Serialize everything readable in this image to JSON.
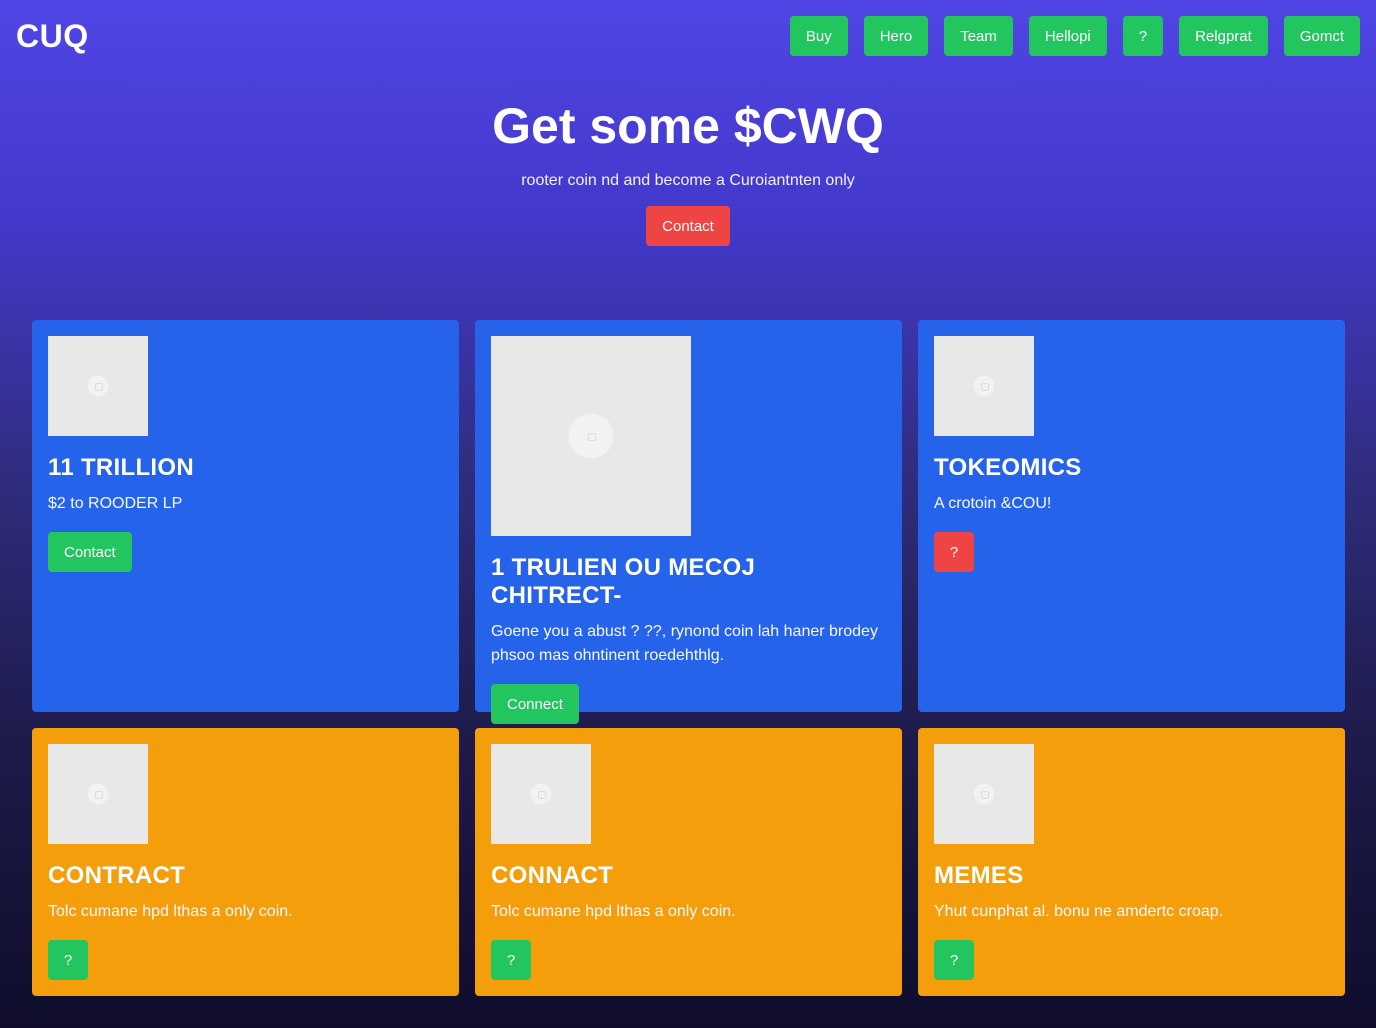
{
  "header": {
    "logo": "CUQ",
    "nav": [
      "Buy",
      "Hero",
      "Team",
      "Hellopi",
      "?",
      "Relgprat",
      "Gomct"
    ]
  },
  "hero": {
    "title": "Get some $CWQ",
    "subtitle": "rooter coin nd and become a Curoiantnten only",
    "cta": "Contact"
  },
  "cards": [
    {
      "title": "11 TRILLION",
      "text": "$2 to ROODER LP",
      "button": "Contact",
      "color": "#2563eb",
      "button_color": "#22c55e"
    },
    {
      "title": "1 TRULIEN OU MECOJ CHITRECT-",
      "text": "Goene you a abust ? ??, rynond coin lah haner brodey phsoo mas ohntinent roedehthlg.",
      "button": "Connect",
      "color": "#2563eb",
      "button_color": "#22c55e"
    },
    {
      "title": "TOKEOMICS",
      "text": "A crotoin &COU!",
      "button": "?",
      "color": "#2563eb",
      "button_color": "#ef4444"
    },
    {
      "title": "CONTRACT",
      "text": "Tolc cumane hpd lthas a only coin.",
      "button": "?",
      "color": "#f59e0b",
      "button_color": "#22c55e"
    },
    {
      "title": "CONNACT",
      "text": "Tolc cumane hpd lthas a only coin.",
      "button": "?",
      "color": "#f59e0b",
      "button_color": "#22c55e"
    },
    {
      "title": "MEMES",
      "text": "Yhut cunphat al. bonu ne amdertc croap.",
      "button": "?",
      "color": "#f59e0b",
      "button_color": "#22c55e"
    }
  ],
  "icons": {
    "card_image": "image-placeholder-icon"
  }
}
